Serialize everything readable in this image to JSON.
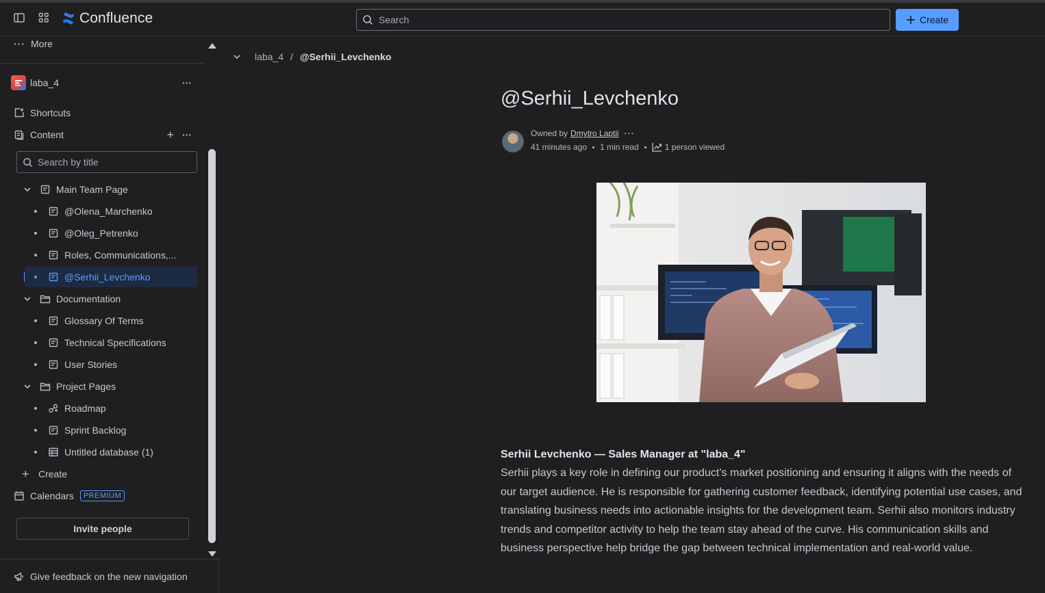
{
  "app": {
    "name": "Confluence",
    "accent": "#579dff"
  },
  "topbar": {
    "search_placeholder": "Search",
    "create_label": "Create"
  },
  "sidebar": {
    "more_label": "More",
    "space_name": "laba_4",
    "shortcuts_label": "Shortcuts",
    "content_label": "Content",
    "search_placeholder": "Search by title",
    "tree": [
      {
        "label": "Main Team Page",
        "icon": "page-icon"
      },
      {
        "label": "@Olena_Marchenko",
        "icon": "page-icon"
      },
      {
        "label": "@Oleg_Petrenko",
        "icon": "page-icon"
      },
      {
        "label": "Roles, Communications,...",
        "icon": "page-icon"
      },
      {
        "label": "@Serhii_Levchenko",
        "icon": "page-icon",
        "selected": true
      },
      {
        "label": "Documentation",
        "icon": "folder-icon"
      },
      {
        "label": "Glossary Of Terms",
        "icon": "page-icon"
      },
      {
        "label": "Technical Specifications",
        "icon": "page-icon"
      },
      {
        "label": "User Stories",
        "icon": "page-icon"
      },
      {
        "label": "Project Pages",
        "icon": "folder-icon"
      },
      {
        "label": "Roadmap",
        "icon": "roadmap-icon"
      },
      {
        "label": "Sprint Backlog",
        "icon": "page-icon"
      },
      {
        "label": "Untitled database (1)",
        "icon": "database-icon"
      }
    ],
    "create_label": "Create",
    "calendars_label": "Calendars",
    "premium_badge": "PREMIUM",
    "invite_label": "Invite people",
    "feedback_label": "Give feedback on the new navigation"
  },
  "page": {
    "breadcrumb_space": "laba_4",
    "breadcrumb_separator": "/",
    "breadcrumb_current": "@Serhii_Levchenko",
    "title": "@Serhii_Levchenko",
    "owned_by_prefix": "Owned by",
    "owner_name": "Dmytro Laptii",
    "edited_ago": "41 minutes ago",
    "read_time": "1 min read",
    "views": "1 person viewed",
    "body_heading": "Serhii Levchenko — Sales Manager at \"laba_4\"",
    "body_paragraph": "Serhii plays a key role in defining our product’s market positioning and ensuring it aligns with the needs of our target audience. He is responsible for gathering customer feedback, identifying potential use cases, and translating business needs into actionable insights for the development team. Serhii also monitors industry trends and competitor activity to help the team stay ahead of the curve. His communication skills and business perspective help bridge the gap between technical implementation and real-world value."
  }
}
